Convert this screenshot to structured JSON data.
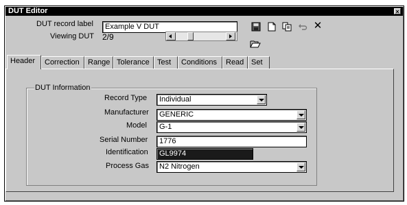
{
  "window": {
    "title": "DUT Editor",
    "close_glyph": "×"
  },
  "record": {
    "label_caption": "DUT record label",
    "label_value": "Example V DUT",
    "viewing_caption": "Viewing DUT",
    "viewing_value": "2/9"
  },
  "toolbar": {
    "icons": [
      "save-icon",
      "new-document-icon",
      "copy-icon",
      "undo-icon",
      "delete-icon",
      "open-folder-icon"
    ],
    "delete_glyph": "✕"
  },
  "tabs": [
    "Header",
    "Correction",
    "Range",
    "Tolerance",
    "Test",
    "Conditions",
    "Read",
    "Set"
  ],
  "active_tab": "Header",
  "dut_info": {
    "group_title": "DUT Information",
    "record_type_label": "Record Type",
    "record_type_value": "Individual",
    "manufacturer_label": "Manufacturer",
    "manufacturer_value": "GENERIC",
    "model_label": "Model",
    "model_value": "G-1",
    "serial_label": "Serial Number",
    "serial_value": "1776",
    "identification_label": "Identification",
    "identification_value": "GL9974",
    "process_gas_label": "Process Gas",
    "process_gas_value": "N2 Nitrogen"
  },
  "colors": {
    "title_bar": "#000000",
    "window_face": "#c8c8c8",
    "selection": "#1a1a1a"
  }
}
